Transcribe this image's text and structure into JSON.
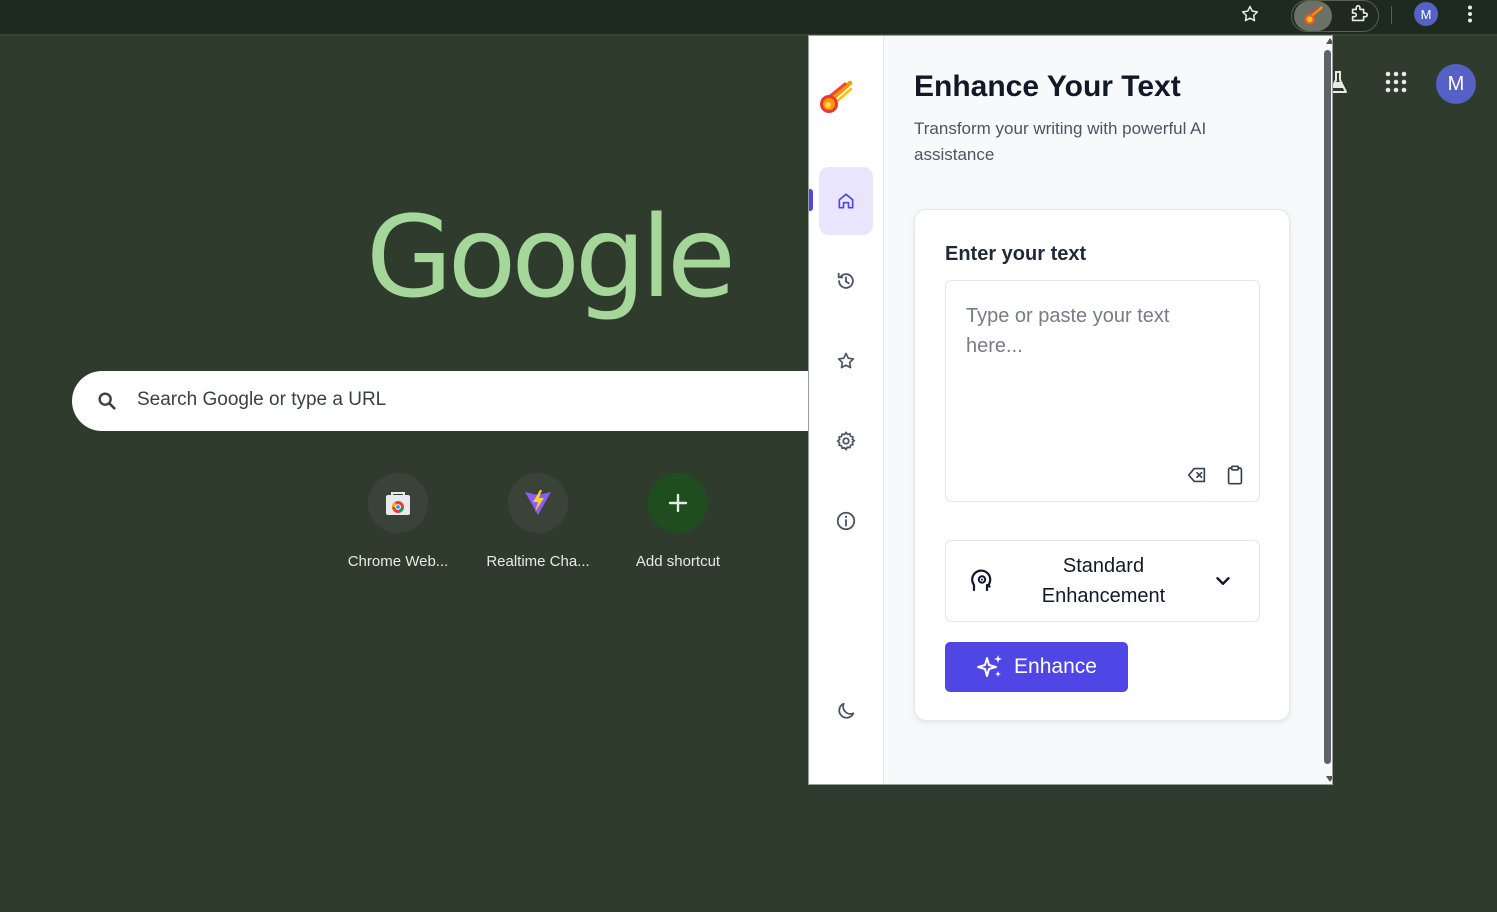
{
  "browser": {
    "profile_initial": "M",
    "extension_icon": "meteor-icon"
  },
  "ntp": {
    "logo": "Google",
    "search_placeholder": "Search Google or type a URL",
    "profile_initial": "M",
    "shortcuts": [
      {
        "label": "Chrome Web...",
        "icon": "chrome-web-store-icon"
      },
      {
        "label": "Realtime Cha...",
        "icon": "vite-icon"
      },
      {
        "label": "Add shortcut",
        "icon": "plus-icon"
      }
    ]
  },
  "popup": {
    "rail": [
      {
        "name": "home",
        "icon": "home-icon",
        "active": true
      },
      {
        "name": "history",
        "icon": "history-icon",
        "active": false
      },
      {
        "name": "favorites",
        "icon": "star-icon",
        "active": false
      },
      {
        "name": "settings",
        "icon": "gear-icon",
        "active": false
      },
      {
        "name": "about",
        "icon": "info-icon",
        "active": false
      },
      {
        "name": "theme",
        "icon": "moon-icon",
        "active": false
      }
    ],
    "title": "Enhance Your Text",
    "subtitle": "Transform your writing with powerful AI assistance",
    "input_label": "Enter your text",
    "input_placeholder": "Type or paste your text here...",
    "mode_selected": "Standard Enhancement",
    "enhance_label": "Enhance"
  },
  "colors": {
    "accent": "#4f46e5",
    "page_bg": "#2f3b2d",
    "google_logo": "#a5d79a"
  }
}
